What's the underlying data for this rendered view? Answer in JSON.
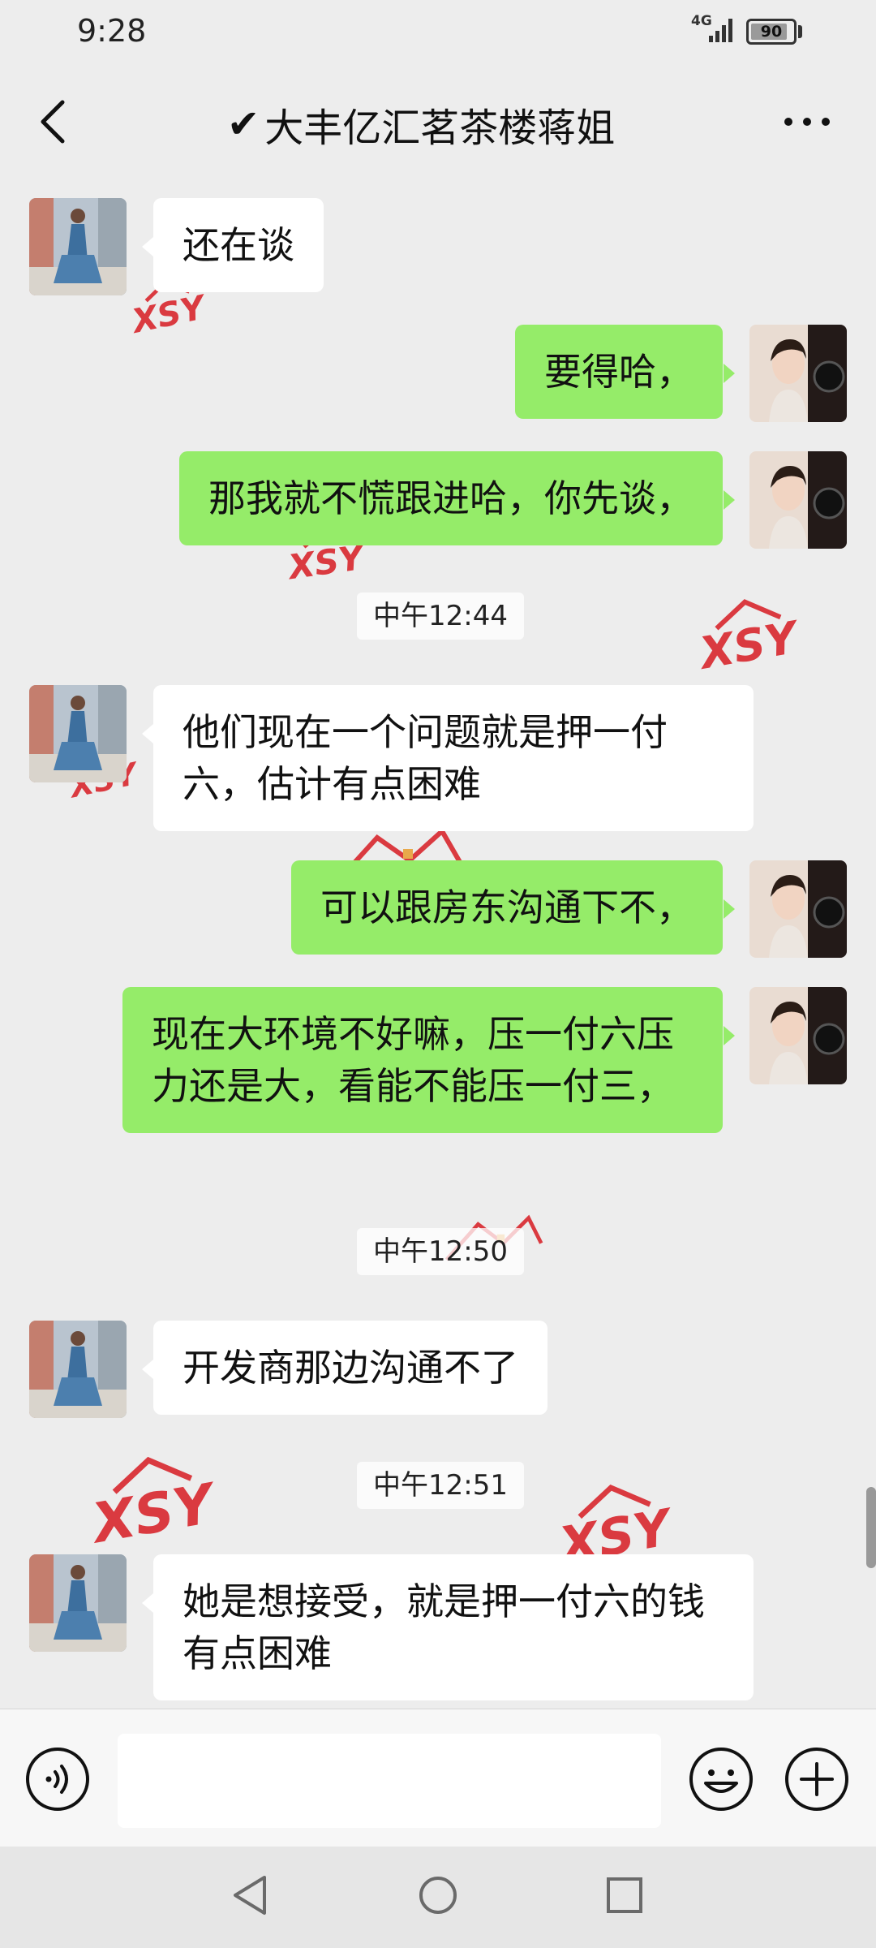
{
  "status": {
    "time": "9:28",
    "network": "4G",
    "battery": "90",
    "battery_fraction": 0.9
  },
  "header": {
    "check_mark": "✔",
    "title": "大丰亿汇茗茶楼蒋姐"
  },
  "messages": [
    {
      "text": "还在谈"
    },
    {
      "text": "要得哈，"
    },
    {
      "text": "那我就不慌跟进哈，你先谈，"
    },
    {
      "text": "他们现在一个问题就是押一付六，估计有点困难"
    },
    {
      "text": "可以跟房东沟通下不，"
    },
    {
      "text": "现在大环境不好嘛，压一付六压力还是大，看能不能压一付三，"
    },
    {
      "text": "开发商那边沟通不了"
    },
    {
      "text": "她是想接受，就是押一付六的钱有点困难"
    }
  ],
  "timestamps": [
    "中午12:44",
    "中午12:50",
    "中午12:51"
  ],
  "watermark_text": "XSY",
  "input": {
    "value": ""
  },
  "colors": {
    "outgoing_bubble": "#95ec69",
    "incoming_bubble": "#ffffff",
    "background": "#ededed",
    "watermark": "#d8272e"
  },
  "icons": [
    "back-arrow-icon",
    "more-dots-icon",
    "voice-icon",
    "emoji-icon",
    "plus-icon",
    "nav-back-icon",
    "nav-home-icon",
    "nav-recent-icon"
  ]
}
